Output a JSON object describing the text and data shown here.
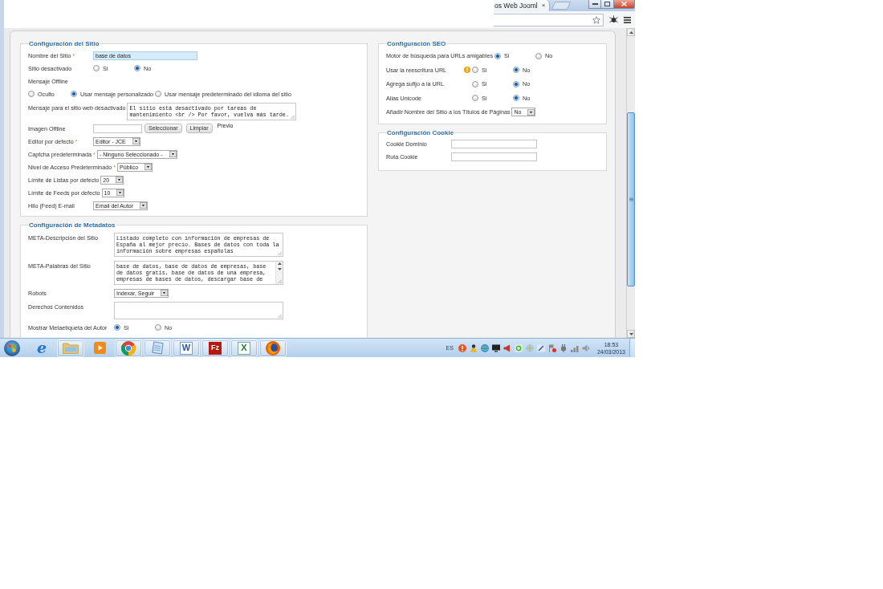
{
  "browser": {
    "tab": {
      "title": "os Web Jooml",
      "close": "×"
    }
  },
  "site_config": {
    "legend": "Configuración del Sitio",
    "fields": [
      {
        "kind": "text",
        "label": "Nombre del Sitio",
        "required_mark": "*",
        "value": "base de datos",
        "highlighted": true
      },
      {
        "kind": "radio",
        "label": "Sitio desactivado",
        "options": [
          {
            "label": "Si",
            "selected": false
          },
          {
            "label": "No",
            "selected": true
          }
        ]
      },
      {
        "kind": "radio_stacked",
        "label": "Mensaje Offline",
        "options": [
          {
            "label": "Oculto",
            "selected": false
          },
          {
            "label": "Usar mensaje personalizado",
            "selected": true
          },
          {
            "label": "Usar mensaje predeterminado del idioma del sitio",
            "selected": false
          }
        ]
      },
      {
        "kind": "textarea",
        "label": "Mensaje para el sitio web desactivado",
        "value": "El sitio está desactivado por tareas de mantenimiento <br /> Por favor, vuelva más tarde."
      },
      {
        "kind": "image",
        "label": "Imagen Offline",
        "buttons": [
          "Seleccionar",
          "Limpiar"
        ],
        "preview": "Previo"
      },
      {
        "kind": "select",
        "label": "Editor por defecto",
        "required_mark": "*",
        "value": "Editor - JCE"
      },
      {
        "kind": "select",
        "label": "Captcha predeterminada",
        "required_mark": "*",
        "value": "- Ninguno Seleccionado -"
      },
      {
        "kind": "select",
        "label": "Nivel de Acceso Predeterminado",
        "required_mark": "*",
        "value": "Público"
      },
      {
        "kind": "select",
        "label": "Límite de Listas por defecto",
        "value": "20"
      },
      {
        "kind": "select",
        "label": "Límite de Feeds por defecto",
        "value": "10"
      },
      {
        "kind": "select",
        "label": "Hilo (Feed) E-mail",
        "value": "Email del Autor"
      }
    ]
  },
  "metadata_config": {
    "legend": "Configuración de Metadatos",
    "fields": [
      {
        "kind": "textarea",
        "label": "META-Descripción del Sitio",
        "value": "Listado completo con información de empresas de España al mejor precio. Bases de datos con toda la información sobre empresas españolas"
      },
      {
        "kind": "textarea",
        "label": "META-Palabras del Sitio",
        "value": "base de datos, base de datos de empresas, base de datos gratis, base de datos de una empresa, empresas de bases de datos, descargar base de",
        "scrollbar": true
      },
      {
        "kind": "select",
        "label": "Robots",
        "value": "Indexar, Seguir"
      },
      {
        "kind": "textarea",
        "label": "Derechos Contenidos"
      },
      {
        "kind": "radio",
        "label": "Mostrar Metaetiqueta del Autor",
        "options": [
          {
            "label": "Si",
            "selected": true
          },
          {
            "label": "No",
            "selected": false
          }
        ]
      }
    ]
  },
  "seo_config": {
    "legend": "Configuración SEO",
    "fields": [
      {
        "kind": "radio",
        "label": "Motor de búsqueda para URLs amigables",
        "options": [
          {
            "label": "Si",
            "selected": true
          },
          {
            "label": "No",
            "selected": false
          }
        ]
      },
      {
        "kind": "radio",
        "label": "Usar la reescritura URL",
        "warning": true,
        "options": [
          {
            "label": "Si",
            "selected": false
          },
          {
            "label": "No",
            "selected": true
          }
        ]
      },
      {
        "kind": "radio",
        "label": "Agrega sufijo a la URL",
        "options": [
          {
            "label": "Si",
            "selected": false
          },
          {
            "label": "No",
            "selected": true
          }
        ]
      },
      {
        "kind": "radio",
        "label": "Alias Unicode",
        "options": [
          {
            "label": "Si",
            "selected": false
          },
          {
            "label": "No",
            "selected": true
          }
        ]
      },
      {
        "kind": "select",
        "label": "Añadir Nombre del Sitio a los Títulos de Páginas",
        "value": "No"
      }
    ]
  },
  "cookie_config": {
    "legend": "Configuración Cookie",
    "fields": [
      {
        "kind": "text",
        "label": "Cookie Dominio"
      },
      {
        "kind": "text",
        "label": "Ruta Cookie"
      }
    ]
  },
  "taskbar": {
    "apps": [
      {
        "kind": "ie",
        "glyph": "e",
        "running": false
      },
      {
        "kind": "folder",
        "running": true
      },
      {
        "kind": "media",
        "running": false
      },
      {
        "kind": "chrome",
        "running": true
      },
      {
        "kind": "notepad",
        "running": true
      },
      {
        "kind": "word",
        "glyph": "W",
        "running": true
      },
      {
        "kind": "filezilla",
        "glyph": "Fz",
        "running": true
      },
      {
        "kind": "excel",
        "glyph": "X",
        "running": true
      },
      {
        "kind": "firefox",
        "running": true
      }
    ],
    "tray": {
      "language": "ES",
      "time": "18:53",
      "date": "24/03/2013"
    }
  }
}
